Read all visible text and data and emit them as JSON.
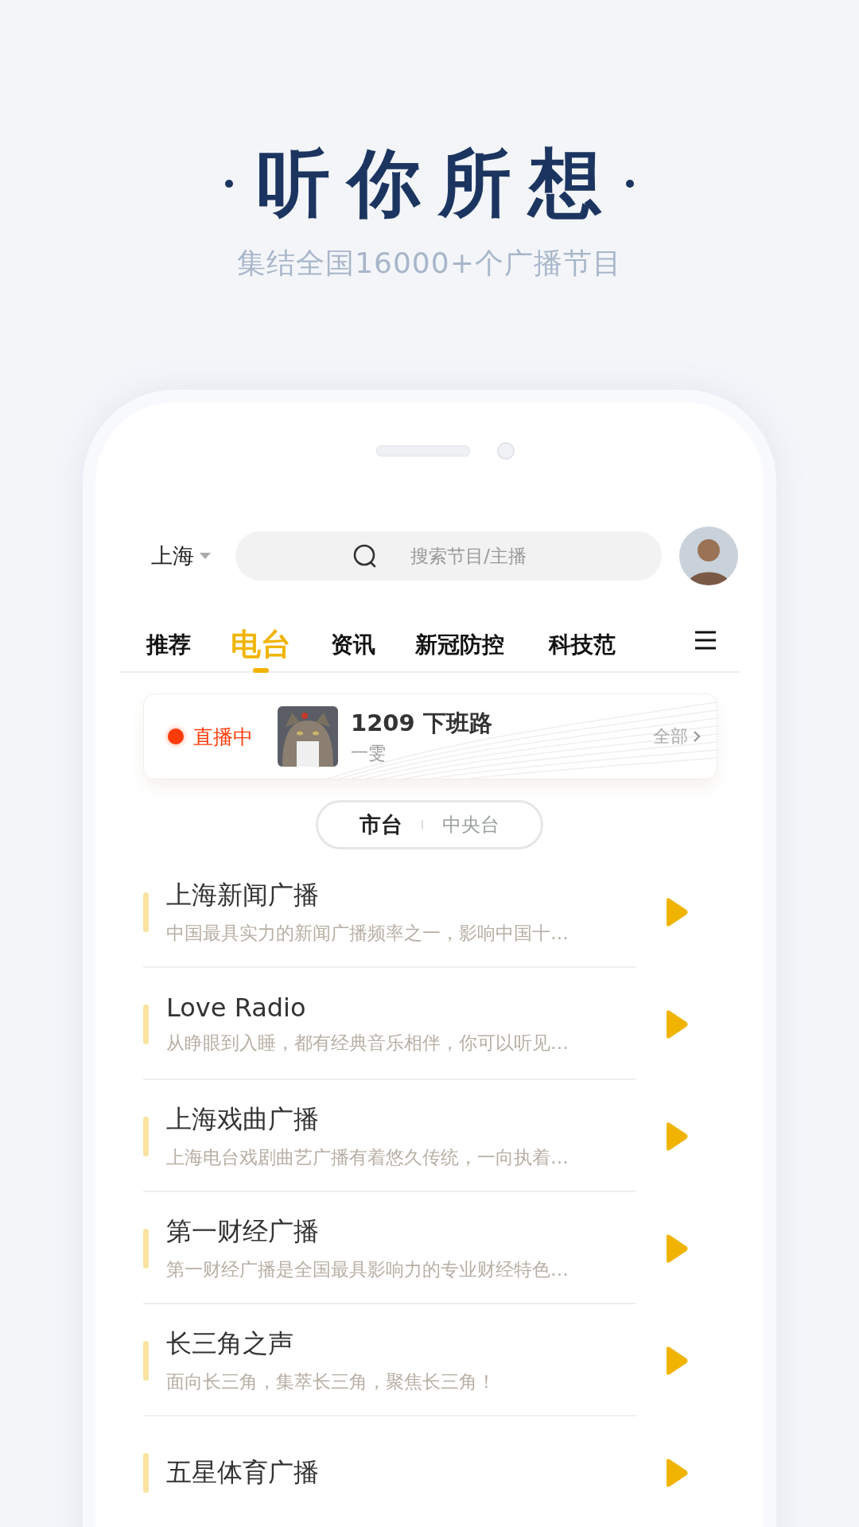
{
  "header": {
    "title": "听你所想",
    "subtitle": "集结全国16000+个广播节目"
  },
  "top_bar": {
    "city": "上海",
    "search": {
      "placeholder": "搜索节目/主播"
    }
  },
  "tabs": [
    {
      "label": "推荐",
      "selected": false
    },
    {
      "label": "电台",
      "selected": true
    },
    {
      "label": "资讯",
      "selected": false
    },
    {
      "label": "新冠防控",
      "selected": false
    },
    {
      "label": "科技范",
      "selected": false
    }
  ],
  "live": {
    "badge": "直播中",
    "title": "1209 下班路",
    "host": "一雯",
    "more": "全部"
  },
  "segments": [
    {
      "label": "市台",
      "selected": true
    },
    {
      "label": "中央台",
      "selected": false
    }
  ],
  "stations": [
    {
      "name": "上海新闻广播",
      "description": "中国最具实力的新闻广播频率之一，影响中国十…"
    },
    {
      "name": "Love Radio",
      "description": "从睁眼到入睡，都有经典音乐相伴，你可以听见…"
    },
    {
      "name": "上海戏曲广播",
      "description": "上海电台戏剧曲艺广播有着悠久传统，一向执着…"
    },
    {
      "name": "第一财经广播",
      "description": "第一财经广播是全国最具影响力的专业财经特色…"
    },
    {
      "name": "长三角之声",
      "description": "面向长三角，集萃长三角，聚焦长三角！"
    },
    {
      "name": "五星体育广播"
    }
  ]
}
